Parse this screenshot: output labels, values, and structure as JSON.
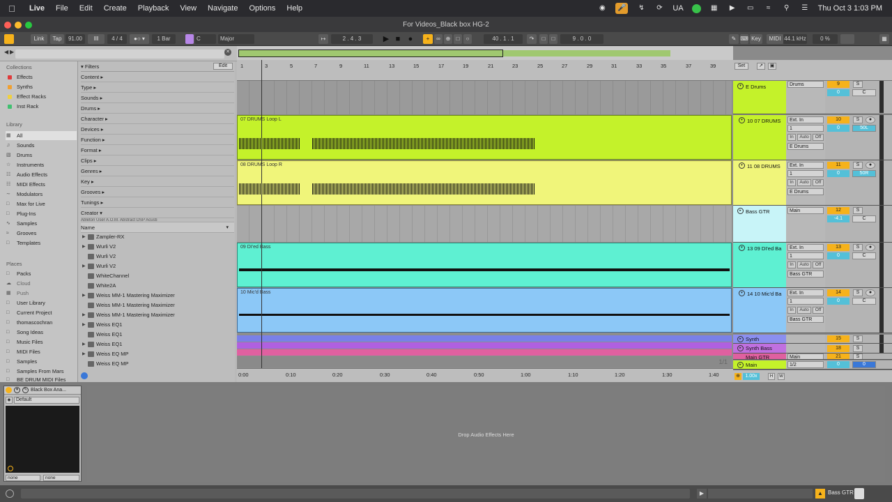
{
  "menubar": {
    "app": "Live",
    "menus": [
      "File",
      "Edit",
      "Create",
      "Playback",
      "View",
      "Navigate",
      "Options",
      "Help"
    ],
    "input_source": "UA",
    "datetime": "Thu Oct 3  1:03 PM"
  },
  "window": {
    "title": "For Videos_Black box HG-2"
  },
  "control_bar": {
    "link": "Link",
    "tap": "Tap",
    "tempo": "91.00",
    "signature": "4 / 4",
    "quantize": "1 Bar",
    "key_root": "C",
    "scale": "Major",
    "position": "2 .  4 .  3",
    "loop_start": "40 .  1 .  1",
    "loop_length": "9 .  0 .  0",
    "key_label": "Key",
    "midi_label": "MIDI",
    "sample_rate": "44.1 kHz",
    "cpu": "0 %"
  },
  "browser": {
    "collections_head": "Collections",
    "collections": [
      {
        "label": "Effects",
        "color": "#e03a3a"
      },
      {
        "label": "Synths",
        "color": "#f0a030"
      },
      {
        "label": "Effect Racks",
        "color": "#f0d040"
      },
      {
        "label": "Inst Rack",
        "color": "#40c070"
      }
    ],
    "library_head": "Library",
    "library": [
      "All",
      "Sounds",
      "Drums",
      "Instruments",
      "Audio Effects",
      "MIDI Effects",
      "Modulators",
      "Max for Live",
      "Plug-Ins",
      "Samples",
      "Grooves",
      "Templates"
    ],
    "places_head": "Places",
    "places": [
      "Packs",
      "Cloud",
      "Push",
      "User Library",
      "Current Project",
      "thomascochran",
      "Song Ideas",
      "Music Files",
      "MIDI Files",
      "Samples",
      "Samples From Mars",
      "BE DRUM MIDI Files"
    ],
    "filters_label": "Filters",
    "edit_label": "Edit",
    "filters": [
      "Content ▸",
      "Type ▸",
      "Sounds ▸",
      "Drums ▸",
      "Character ▸",
      "Devices ▸",
      "Function ▸",
      "Format ▸",
      "Clips ▸",
      "Genres ▸",
      "Key ▸",
      "Grooves ▸",
      "Tunings ▸",
      "Creator ▾"
    ],
    "creator_tags": "Ableton  User  A.O.M.  Abstract DSP  Acusti",
    "name_header": "Name",
    "items": [
      {
        "label": "Zampler-RX",
        "expand": true
      },
      {
        "label": "Wurli V2",
        "expand": true
      },
      {
        "label": "Wurli V2",
        "expand": false
      },
      {
        "label": "Wurli V2",
        "expand": true
      },
      {
        "label": "WhiteChannel",
        "expand": false
      },
      {
        "label": "White2A",
        "expand": false
      },
      {
        "label": "Weiss MM-1 Mastering Maximizer",
        "expand": true
      },
      {
        "label": "Weiss MM-1 Mastering Maximizer",
        "expand": false
      },
      {
        "label": "Weiss MM-1 Mastering Maximizer",
        "expand": true
      },
      {
        "label": "Weiss EQ1",
        "expand": true
      },
      {
        "label": "Weiss EQ1",
        "expand": false
      },
      {
        "label": "Weiss EQ1",
        "expand": true
      },
      {
        "label": "Weiss EQ MP",
        "expand": true
      },
      {
        "label": "Weiss EQ MP",
        "expand": false
      }
    ]
  },
  "arrangement": {
    "bars": [
      "1",
      "3",
      "5",
      "7",
      "9",
      "11",
      "13",
      "15",
      "17",
      "19",
      "21",
      "23",
      "25",
      "27",
      "29",
      "31",
      "33",
      "35",
      "37",
      "39"
    ],
    "times": [
      "0:00",
      "0:10",
      "0:20",
      "0:30",
      "0:40",
      "0:50",
      "1:00",
      "1:10",
      "1:20",
      "1:30",
      "1:40"
    ],
    "set_label": "Set",
    "page_indicator": "1/1",
    "clips": [
      {
        "title": "07 DRUMS Loop L",
        "color": "#c4f22a"
      },
      {
        "title": "08 DRUMS Loop R",
        "color": "#f0f57a"
      },
      {
        "title": "09 DI'ed Bass",
        "color": "#5ef0d2"
      },
      {
        "title": "10 Mic'd Bass",
        "color": "#8cc8f7"
      }
    ]
  },
  "tracks": [
    {
      "name": "E Drums",
      "color": "#c4f22a",
      "io": "Drums",
      "num": "9",
      "vol": "0",
      "pan": "C"
    },
    {
      "name": "10 07 DRUMS",
      "color": "#c4f22a",
      "input": "Ext. In",
      "channel": "1",
      "monitor": "Auto",
      "output": "E Drums",
      "num": "10",
      "vol": "0",
      "pan": "50L"
    },
    {
      "name": "11 08 DRUMS",
      "color": "#f0f57a",
      "input": "Ext. In",
      "channel": "1",
      "monitor": "Auto",
      "output": "E Drums",
      "num": "11",
      "vol": "0",
      "pan": "50R"
    },
    {
      "name": "Bass GTR",
      "color": "#c8f4f8",
      "io": "Main",
      "num": "12",
      "vol": "-4.1",
      "pan": "C"
    },
    {
      "name": "13 09 DI'ed Ba",
      "color": "#5ef0d2",
      "input": "Ext. In",
      "channel": "1",
      "monitor": "Auto",
      "output": "Bass GTR",
      "num": "13",
      "vol": "0",
      "pan": "C"
    },
    {
      "name": "14 10 Mic'd Ba",
      "color": "#8cc8f7",
      "input": "Ext. In",
      "channel": "1",
      "monitor": "Auto",
      "output": "Bass GTR",
      "num": "14",
      "vol": "0",
      "pan": "C"
    },
    {
      "name": "Synth",
      "color": "#8b8ff0",
      "num": "15"
    },
    {
      "name": "Synth Bass",
      "color": "#c070e0",
      "num": "18"
    },
    {
      "name": "Main GTR",
      "color": "#e060a0",
      "io": "Main",
      "num": "21"
    },
    {
      "name": "Main",
      "color": "#c4f22a",
      "io": "1/2",
      "num": "0",
      "vol": "0"
    }
  ],
  "monitor_in": "In",
  "monitor_off": "Off",
  "solo_label": "S",
  "zoom": "1.00x",
  "hw_h": "H",
  "hw_w": "W",
  "device": {
    "name": "Black Box Ana...",
    "preset": "Default",
    "route_a": "none",
    "route_b": "none"
  },
  "dropzone_text": "Drop Audio Effects Here",
  "status": {
    "selected_track": "Bass GTR"
  }
}
